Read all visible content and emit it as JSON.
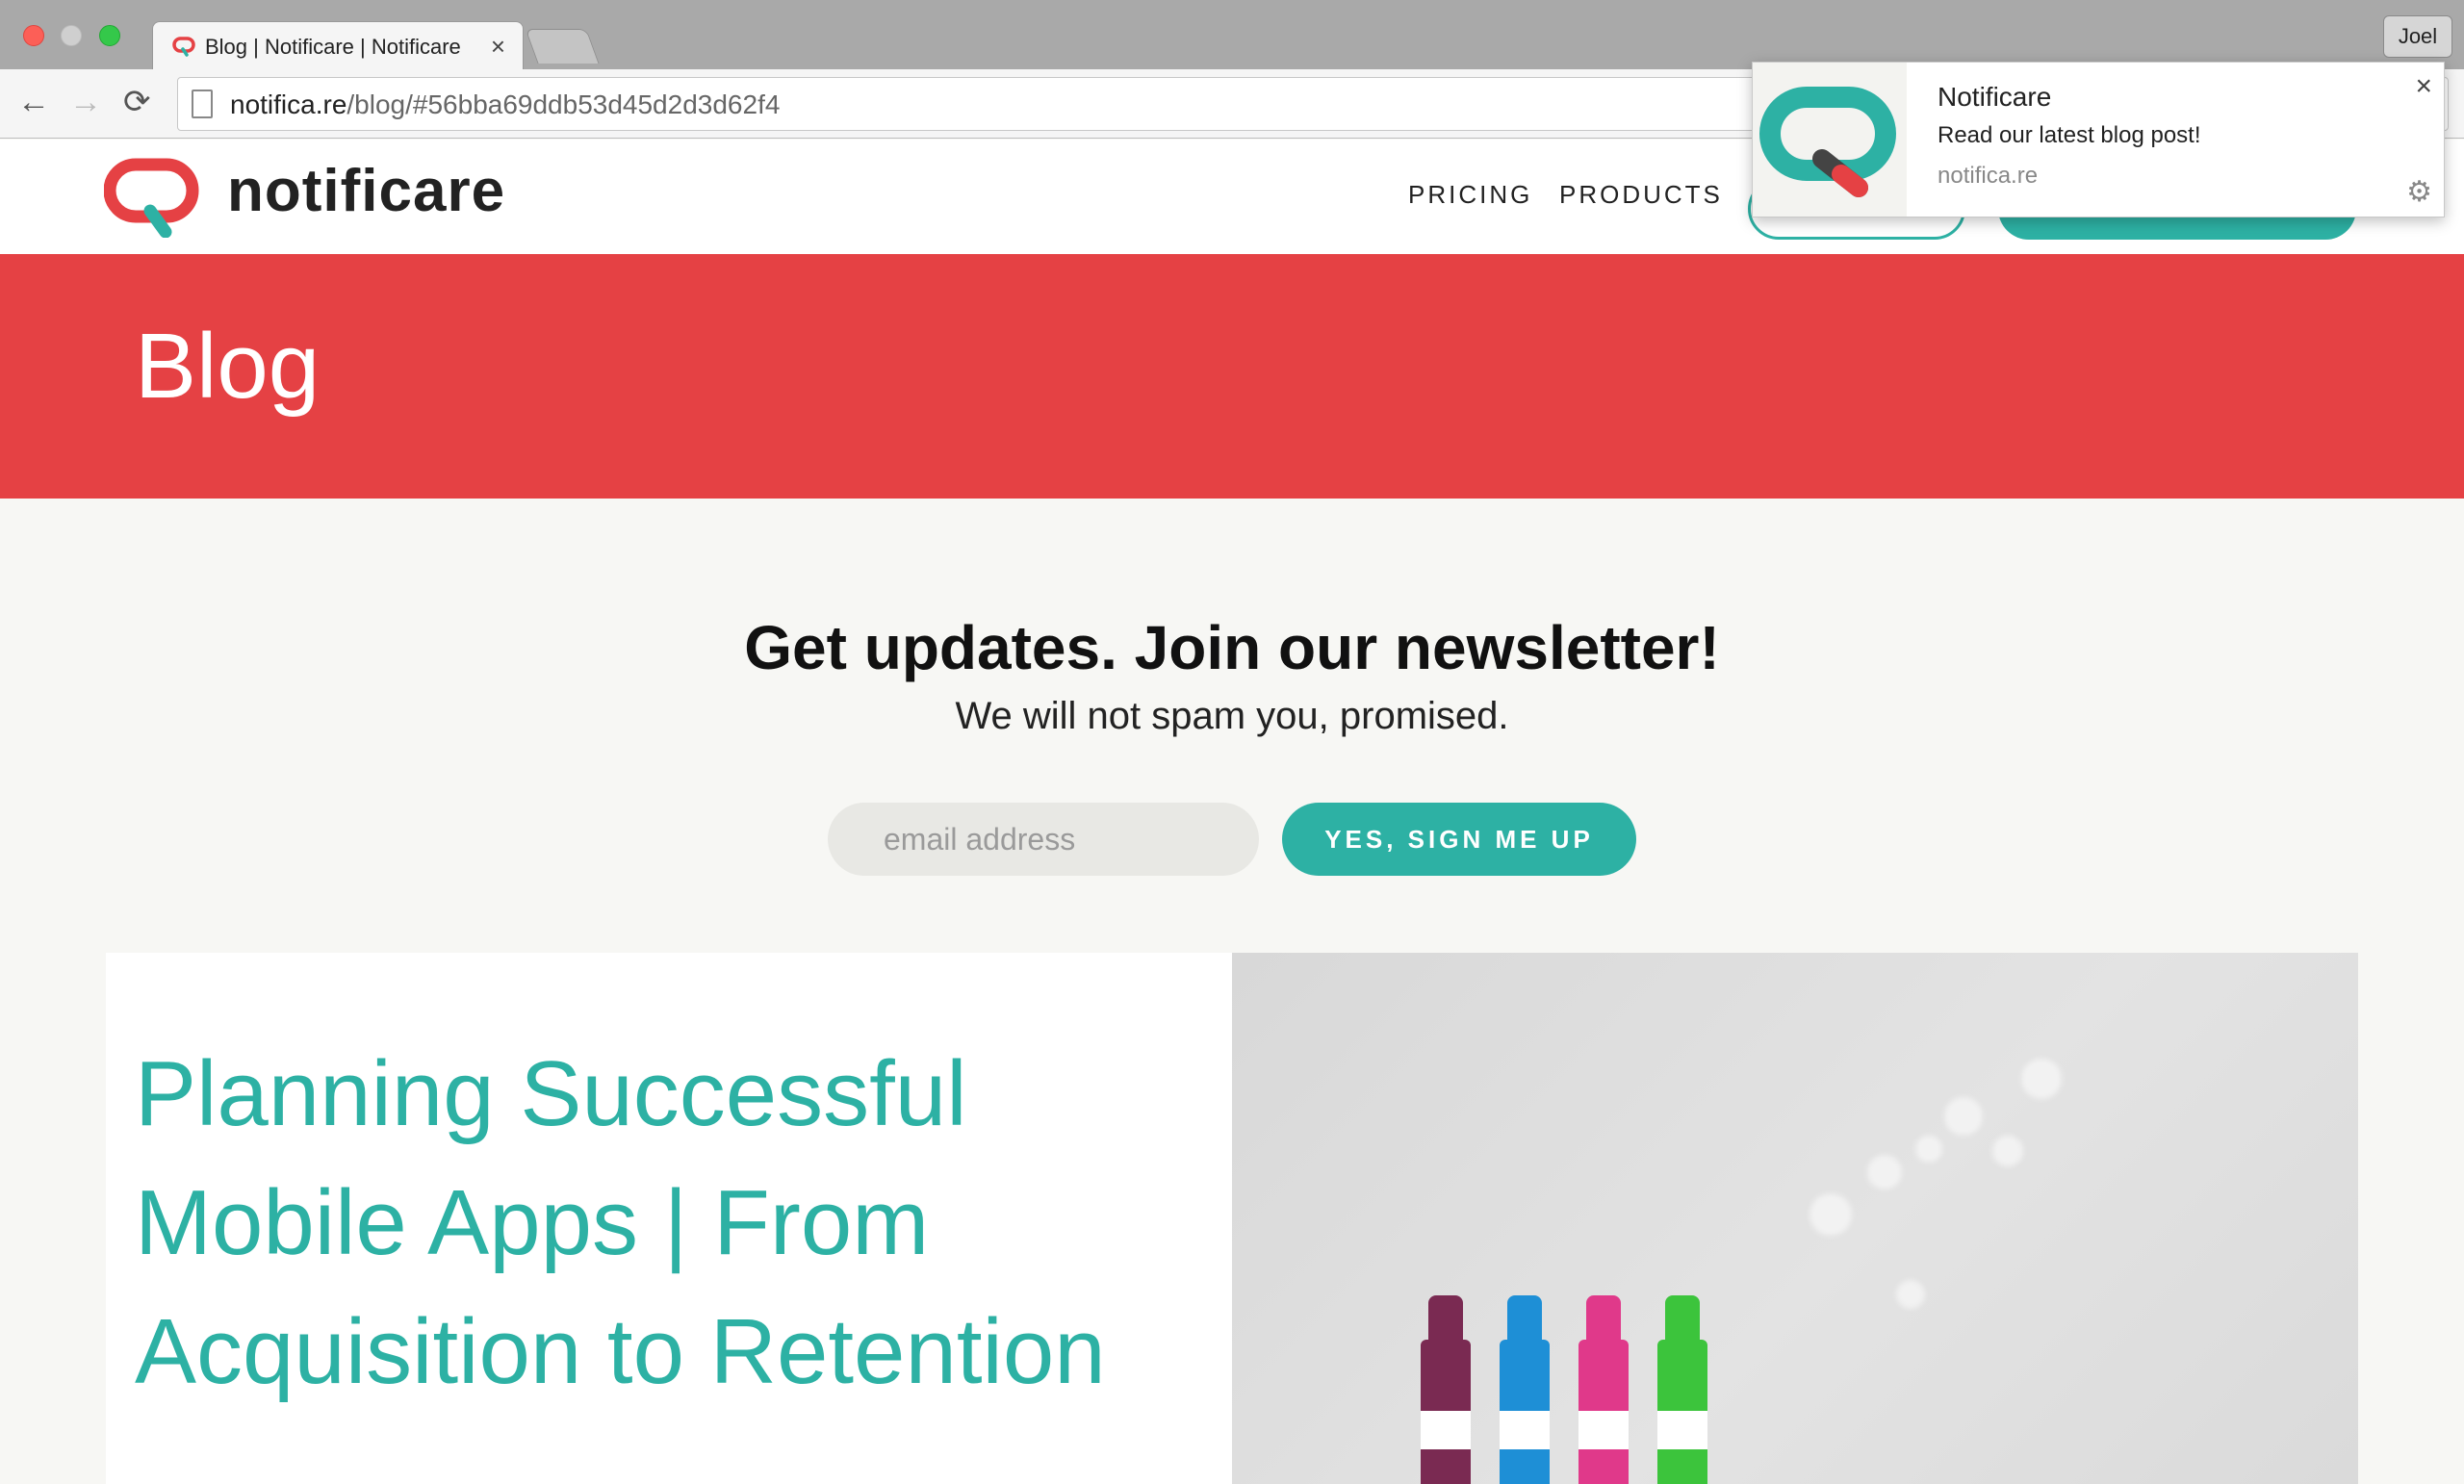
{
  "browser": {
    "tab_title": "Blog | Notificare | Notificare",
    "tab_close": "×",
    "profile_name": "Joel",
    "url_host": "notifica.re",
    "url_path": "/blog/#56bba69ddb53d45d2d3d62f4",
    "back_glyph": "←",
    "forward_glyph": "→",
    "reload_glyph": "⟳"
  },
  "header": {
    "logo_text": "notificare",
    "nav": [
      "PRICING",
      "PRODUCTS"
    ]
  },
  "hero": {
    "title": "Blog"
  },
  "newsletter": {
    "title": "Get updates. Join our newsletter!",
    "subtitle": "We will not spam you, promised.",
    "email_placeholder": "email address",
    "button_label": "YES, SIGN ME UP"
  },
  "post": {
    "title": "Planning Successful Mobile Apps | From Acquisition to Retention"
  },
  "notification": {
    "title": "Notificare",
    "body": "Read our latest blog post!",
    "origin": "notifica.re",
    "close_glyph": "×",
    "gear_glyph": "⚙"
  },
  "colors": {
    "brand_teal": "#2db1a4",
    "brand_red": "#e54144",
    "page_bg": "#f7f7f4"
  },
  "icons": [
    "back-arrow-icon",
    "forward-arrow-icon",
    "reload-icon",
    "page-icon",
    "close-icon",
    "gear-icon",
    "notificare-logo-icon"
  ]
}
